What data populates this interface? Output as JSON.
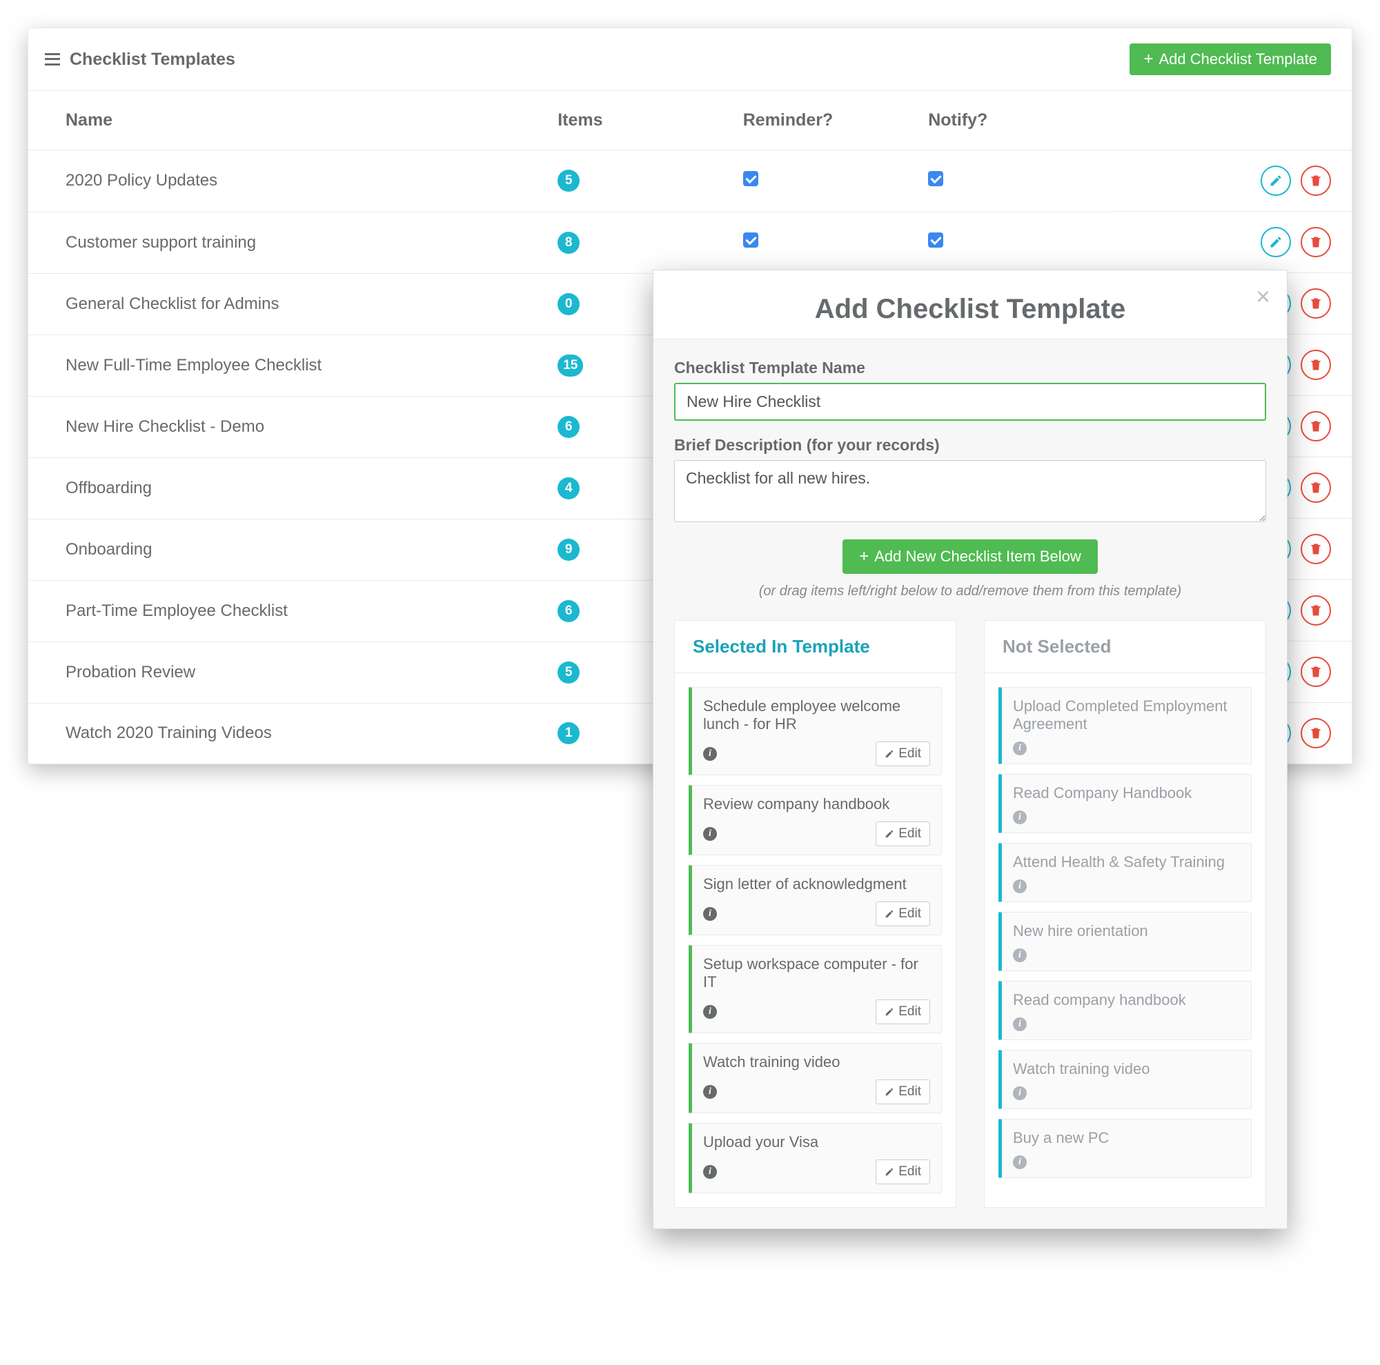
{
  "header": {
    "title": "Checklist Templates",
    "add_button": "Add Checklist Template"
  },
  "table": {
    "columns": {
      "name": "Name",
      "items": "Items",
      "reminder": "Reminder?",
      "notify": "Notify?"
    },
    "rows": [
      {
        "name": "2020 Policy Updates",
        "items": "5",
        "reminder": true,
        "notify": true
      },
      {
        "name": "Customer support training",
        "items": "8",
        "reminder": true,
        "notify": true
      },
      {
        "name": "General Checklist for Admins",
        "items": "0",
        "reminder": false,
        "notify": false
      },
      {
        "name": "New Full-Time Employee Checklist",
        "items": "15",
        "reminder": false,
        "notify": false
      },
      {
        "name": "New Hire Checklist - Demo",
        "items": "6",
        "reminder": false,
        "notify": false
      },
      {
        "name": "Offboarding",
        "items": "4",
        "reminder": false,
        "notify": false
      },
      {
        "name": "Onboarding",
        "items": "9",
        "reminder": false,
        "notify": false
      },
      {
        "name": "Part-Time Employee Checklist",
        "items": "6",
        "reminder": false,
        "notify": false
      },
      {
        "name": "Probation Review",
        "items": "5",
        "reminder": false,
        "notify": false
      },
      {
        "name": "Watch 2020 Training Videos",
        "items": "1",
        "reminder": false,
        "notify": false
      }
    ]
  },
  "modal": {
    "title": "Add Checklist Template",
    "name_label": "Checklist Template Name",
    "name_value": "New Hire Checklist",
    "desc_label": "Brief Description (for your records)",
    "desc_value": "Checklist for all new hires.",
    "add_item_button": "Add New Checklist Item Below",
    "hint": "(or drag items left/right below to add/remove them from this template)",
    "selected_header": "Selected In Template",
    "unselected_header": "Not Selected",
    "edit_label": "Edit",
    "selected_items": [
      "Schedule employee welcome lunch - for HR",
      "Review company handbook",
      "Sign letter of acknowledgment",
      "Setup workspace computer - for IT",
      "Watch training video",
      "Upload your Visa"
    ],
    "unselected_items": [
      "Upload Completed Employment Agreement",
      "Read Company Handbook",
      "Attend Health & Safety Training",
      "New hire orientation",
      "Read company handbook",
      "Watch training video",
      "Buy a new PC"
    ]
  }
}
